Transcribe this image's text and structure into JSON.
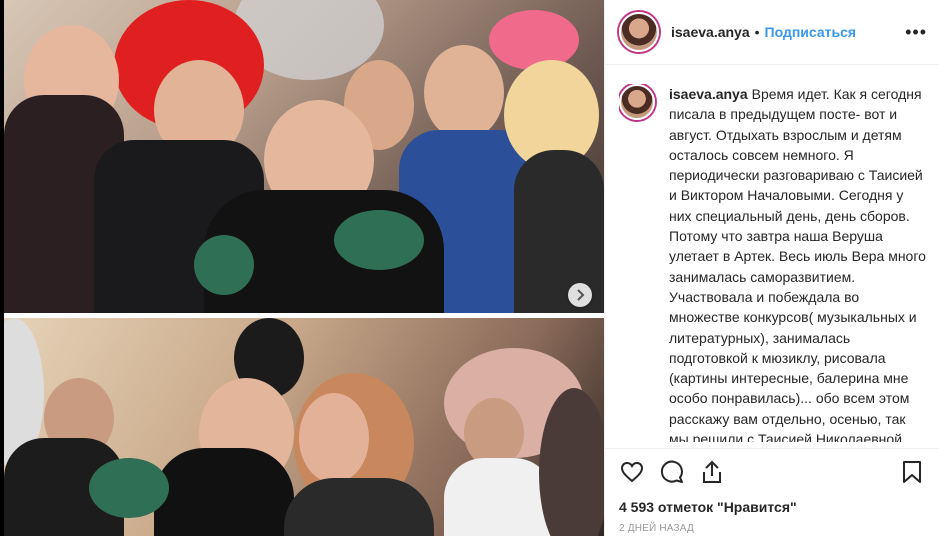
{
  "post": {
    "username": "isaeva.anya",
    "separator": "•",
    "follow_label": "Подписаться",
    "more_label": "•••",
    "caption_user": "isaeva.anya",
    "caption_text": "Время идет. Как я сегодня писала в предыдущем посте- вот и август. Отдыхать взрослым и детям осталось совсем немного. Я периодически разговариваю с Таисией и Виктором Началовыми. Сегодня у них специальный день, день сборов. Потому что завтра наша Веруша улетает в Артек. Весь июль Вера много занималась саморазвитием. Участвовала и побеждала во множестве конкурсов( музыкальных и литературных), занималась подготовкой к мюзиклу, рисовала (картины интересные, балерина мне особо понравилась)... обо всем этом расскажу вам отдельно, осенью, так мы решили с Таисией Николаевной, покажем победы Вероники. Наконец",
    "likes_text": "4 593 отметок \"Нравится\"",
    "time_text": "2 дней назад"
  },
  "icons": {
    "like": "heart-icon",
    "comment": "comment-icon",
    "share": "share-icon",
    "save": "bookmark-icon",
    "next": "chevron-right-icon"
  },
  "colors": {
    "accent": "#3897f0",
    "text": "#262626",
    "muted": "#999999"
  }
}
